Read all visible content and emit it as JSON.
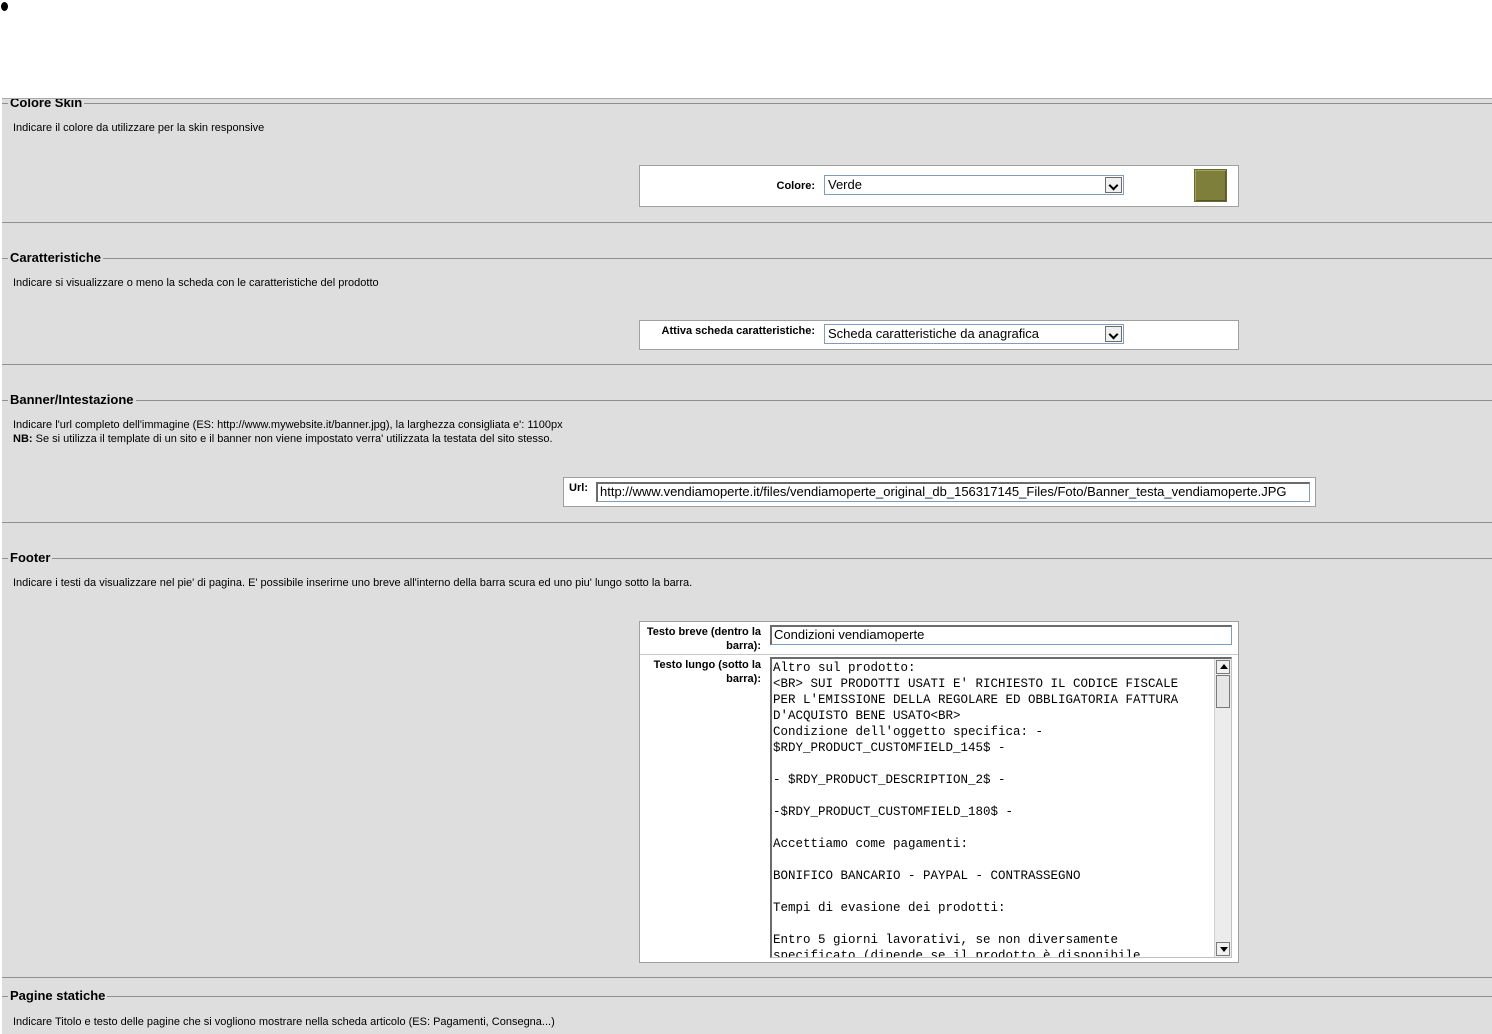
{
  "colore_skin": {
    "title": "Colore Skin",
    "description": "Indicare il colore da utilizzare per la skin responsive",
    "label": "Colore:",
    "selected": "Verde",
    "swatch_color": "#7f7f3c"
  },
  "caratteristiche": {
    "title": "Caratteristiche",
    "description": "Indicare si visualizzare o meno la scheda con le caratteristiche del prodotto",
    "label": "Attiva scheda caratteristiche:",
    "selected": "Scheda caratteristiche da anagrafica"
  },
  "banner": {
    "title": "Banner/Intestazione",
    "description": "Indicare l'url completo dell'immagine (ES: http://www.mywebsite.it/banner.jpg), la larghezza consigliata e': 1100px",
    "nb_label": "NB:",
    "nb_text": " Se si utilizza il template di un sito e il banner non viene impostato verra' utilizzata la testata del sito stesso.",
    "url_label": "Url:",
    "url_value": "http://www.vendiamoperte.it/files/vendiamoperte_original_db_156317145_Files/Foto/Banner_testa_vendiamoperte.JPG"
  },
  "footer": {
    "title": "Footer",
    "description": "Indicare i testi da visualizzare nel pie' di pagina. E' possibile inserirne uno breve all'interno della barra scura ed uno piu' lungo sotto la barra.",
    "short_label": "Testo breve (dentro la barra):",
    "short_value": "Condizioni vendiamoperte",
    "long_label": "Testo lungo (sotto la barra):",
    "long_value": "Altro sul prodotto:\n<BR> SUI PRODOTTI USATI E' RICHIESTO IL CODICE FISCALE\nPER L'EMISSIONE DELLA REGOLARE ED OBBLIGATORIA FATTURA\nD'ACQUISTO BENE USATO<BR>\nCondizione dell'oggetto specifica: -\n$RDY_PRODUCT_CUSTOMFIELD_145$ -\n\n- $RDY_PRODUCT_DESCRIPTION_2$ -\n\n-$RDY_PRODUCT_CUSTOMFIELD_180$ -\n\nAccettiamo come pagamenti:\n\nBONIFICO BANCARIO - PAYPAL - CONTRASSEGNO\n\nTempi di evasione dei prodotti:\n\nEntro 5 giorni lavorativi, se non diversamente\nspecificato (dipende se il prodotto è disponibile"
  },
  "pagine_statiche": {
    "title": "Pagine statiche",
    "description": "Indicare Titolo e testo delle pagine che si vogliono mostrare nella scheda articolo (ES: Pagamenti, Consegna...)"
  }
}
